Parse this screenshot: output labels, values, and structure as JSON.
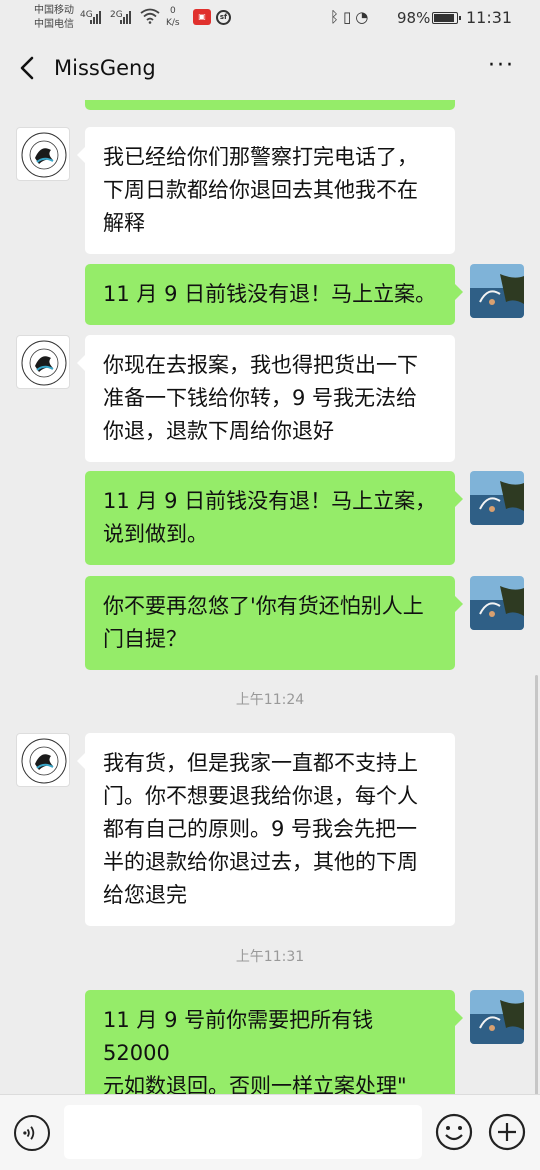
{
  "status_bar": {
    "carrier_1": "中国移动",
    "carrier_2": "中国电信",
    "net_1": "4G",
    "net_2": "2G",
    "speed_value": "0",
    "speed_unit": "K/s",
    "battery": "98%",
    "time": "11:31"
  },
  "header": {
    "title": "MissGeng",
    "more_label": "···"
  },
  "colors": {
    "background": "#ededed",
    "bubble_out": "#95ec69",
    "bubble_in": "#ffffff"
  },
  "messages": [
    {
      "side": "in",
      "lines": [
        "我已经给你们那警察打完电话了，",
        "下周日款都给你退回去其他我不在",
        "解释"
      ]
    },
    {
      "side": "out",
      "lines": [
        "11 月 9 日前钱没有退！马上立案。"
      ]
    },
    {
      "side": "in",
      "lines": [
        "你现在去报案，我也得把货出一下",
        "准备一下钱给你转，9 号我无法给",
        "你退，退款下周给你退好"
      ]
    },
    {
      "side": "out",
      "lines": [
        "11 月 9 日前钱没有退！马上立案，",
        "说到做到。"
      ]
    },
    {
      "side": "out",
      "lines": [
        "你不要再忽悠了'你有货还怕别人上",
        "门自提？"
      ]
    },
    {
      "side": "time",
      "text": "上午11:24"
    },
    {
      "side": "in",
      "lines": [
        "我有货，但是我家一直都不支持上",
        "门。你不想要退我给你退，每个人",
        "都有自己的原则。9 号我会先把一",
        "半的退款给你退过去，其他的下周",
        "给您退完"
      ]
    },
    {
      "side": "time",
      "text": "上午11:31"
    },
    {
      "side": "out",
      "lines": [
        "11 月 9 号前你需要把所有钱 52000",
        "元如数退回。否则一样立案处理\""
      ]
    }
  ]
}
